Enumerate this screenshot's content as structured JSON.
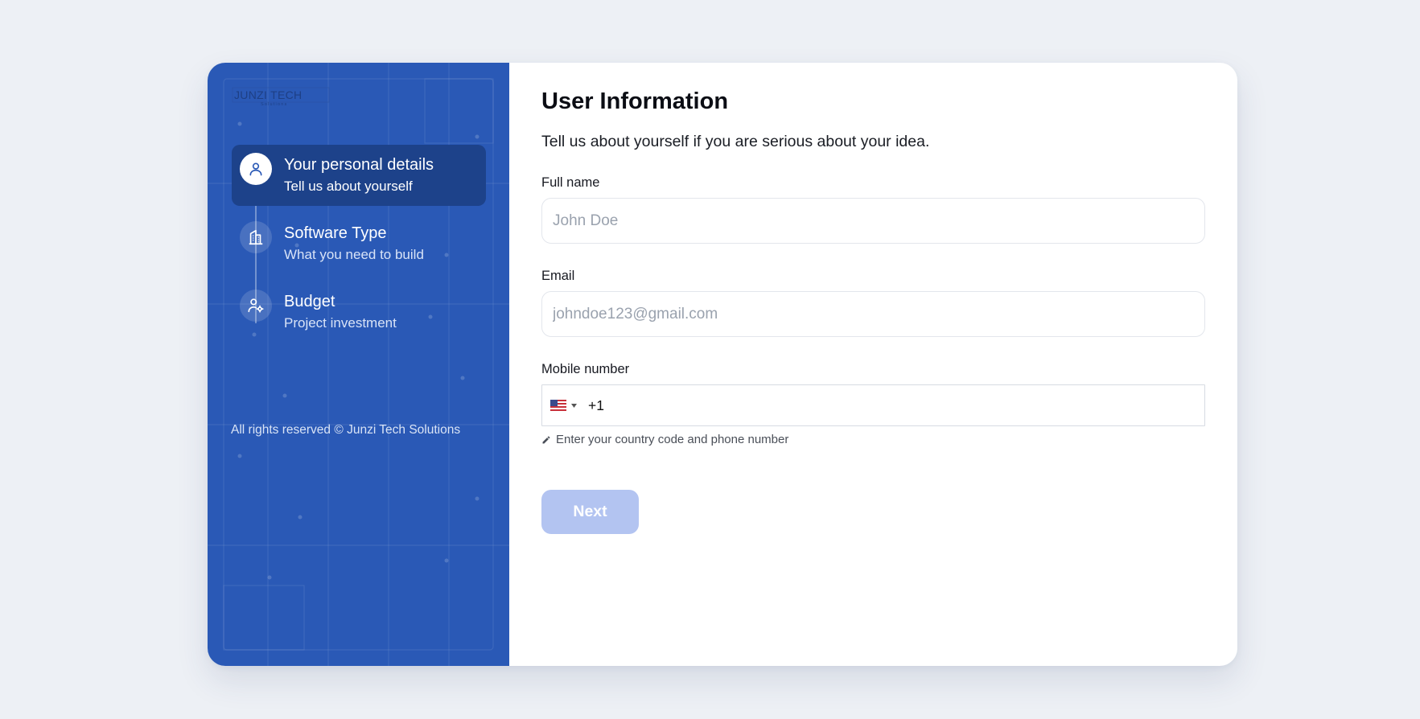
{
  "brand": {
    "logo_text": "JUNZI TECH",
    "logo_subtext": "Solutions"
  },
  "sidebar": {
    "steps": [
      {
        "title": "Your personal details",
        "subtitle": "Tell us about yourself",
        "icon": "user-icon",
        "active": true
      },
      {
        "title": "Software Type",
        "subtitle": "What you need to build",
        "icon": "building-icon",
        "active": false
      },
      {
        "title": "Budget",
        "subtitle": "Project investment",
        "icon": "user-settings-icon",
        "active": false
      }
    ],
    "footer": "All rights reserved © Junzi Tech Solutions"
  },
  "form": {
    "title": "User Information",
    "subtitle": "Tell us about yourself if you are serious about your idea.",
    "full_name": {
      "label": "Full name",
      "placeholder": "John Doe",
      "value": ""
    },
    "email": {
      "label": "Email",
      "placeholder": "johndoe123@gmail.com",
      "value": ""
    },
    "mobile": {
      "label": "Mobile number",
      "country": "US",
      "value": "+1",
      "hint": "Enter your country code and phone number"
    },
    "next_label": "Next"
  },
  "colors": {
    "page_bg": "#edf0f5",
    "sidebar_bg": "#2a59b6",
    "active_step_bg": "#1d428a",
    "next_button_disabled": "#b3c4f1"
  }
}
